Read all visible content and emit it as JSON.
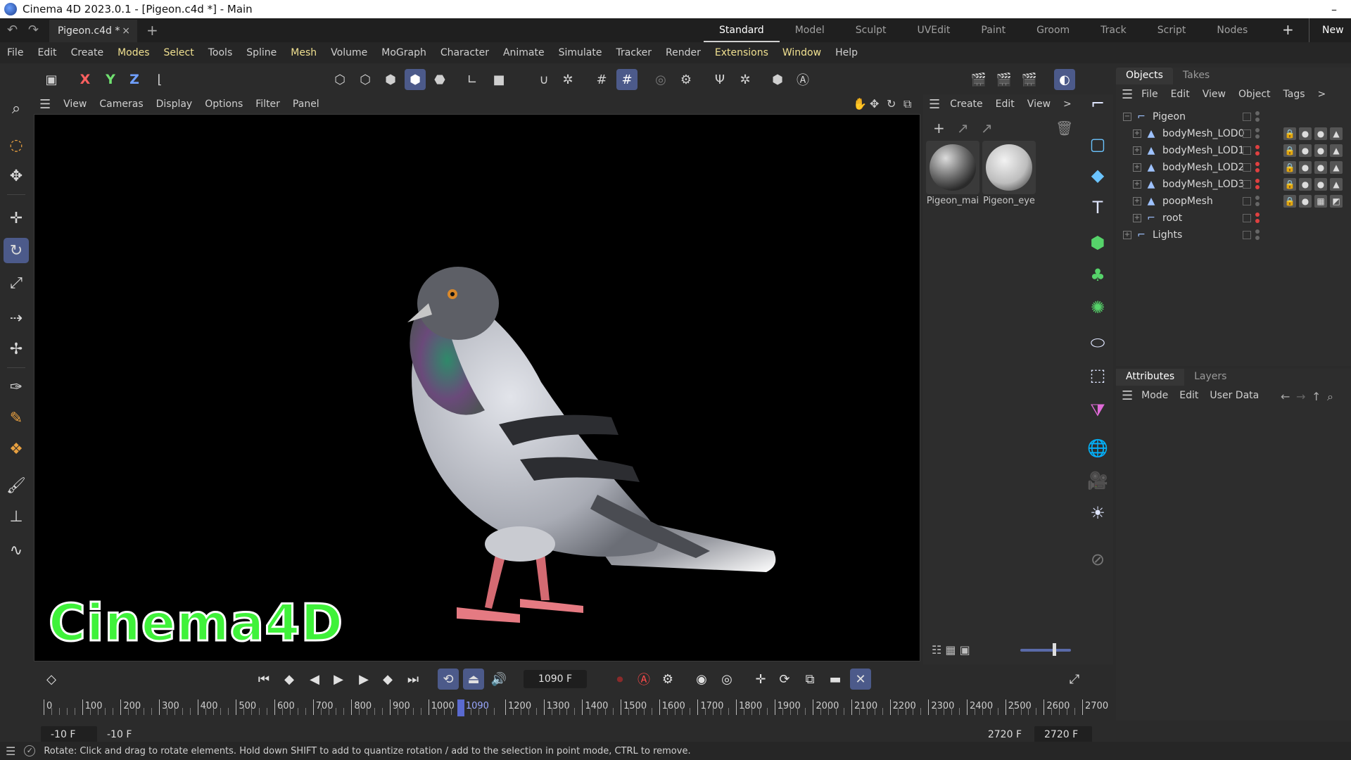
{
  "window": {
    "title": "Cinema 4D 2023.0.1 - [Pigeon.c4d *] - Main",
    "minimize": "–"
  },
  "tabbar": {
    "undo": "↶",
    "redo": "↷",
    "doc_tab": "Pigeon.c4d *",
    "doc_close": "×",
    "add_tab": "+",
    "layouts": [
      "Standard",
      "Model",
      "Sculpt",
      "UVEdit",
      "Paint",
      "Groom",
      "Track",
      "Script",
      "Nodes"
    ],
    "active_layout": "Standard",
    "add_layout": "+",
    "new_layout": "New L"
  },
  "menu": [
    "File",
    "Edit",
    "Create",
    "Modes",
    "Select",
    "Tools",
    "Spline",
    "Mesh",
    "Volume",
    "MoGraph",
    "Character",
    "Animate",
    "Simulate",
    "Tracker",
    "Render",
    "Extensions",
    "Window",
    "Help"
  ],
  "toolbar": {
    "x": "X",
    "y": "Y",
    "z": "Z"
  },
  "viewport": {
    "menu": [
      "View",
      "Cameras",
      "Display",
      "Options",
      "Filter",
      "Panel"
    ],
    "watermark": "Cinema4D"
  },
  "material_manager": {
    "menu": [
      "Create",
      "Edit",
      "View"
    ],
    "more": ">",
    "materials": [
      {
        "name": "Pigeon_mai"
      },
      {
        "name": "Pigeon_eye"
      }
    ]
  },
  "objects_panel": {
    "tabs": [
      "Objects",
      "Takes"
    ],
    "menu": [
      "File",
      "Edit",
      "View",
      "Object",
      "Tags"
    ],
    "more": ">",
    "rows": [
      {
        "name": "Pigeon",
        "level": 0,
        "icon": "null-icon"
      },
      {
        "name": "bodyMesh_LOD0",
        "level": 1,
        "icon": "mesh-icon"
      },
      {
        "name": "bodyMesh_LOD1",
        "level": 1,
        "icon": "mesh-icon"
      },
      {
        "name": "bodyMesh_LOD2",
        "level": 1,
        "icon": "mesh-icon"
      },
      {
        "name": "bodyMesh_LOD3",
        "level": 1,
        "icon": "mesh-icon"
      },
      {
        "name": "poopMesh",
        "level": 1,
        "icon": "mesh-icon"
      },
      {
        "name": "root",
        "level": 1,
        "icon": "joint-icon"
      },
      {
        "name": "Lights",
        "level": 0,
        "icon": "null-icon"
      }
    ]
  },
  "attributes_panel": {
    "tabs": [
      "Attributes",
      "Layers"
    ],
    "menu": [
      "Mode",
      "Edit",
      "User Data"
    ]
  },
  "timeline": {
    "current_frame": "1090 F",
    "ruler_labels": [
      "0",
      "100",
      "200",
      "300",
      "400",
      "500",
      "600",
      "700",
      "800",
      "900",
      "1000",
      "1090",
      "1200",
      "1300",
      "1400",
      "1500",
      "1600",
      "1700",
      "1800",
      "1900",
      "2000",
      "2100",
      "2200",
      "2300",
      "2400",
      "2500",
      "2600",
      "2700"
    ],
    "range_start": "-10 F",
    "range_start2": "-10 F",
    "range_end": "2720 F",
    "range_end2": "2720 F",
    "min_frame": -10,
    "max_frame": 2720,
    "playhead_frame": 1090
  },
  "status": {
    "message": "Rotate: Click and drag to rotate elements. Hold down SHIFT to add to quantize rotation / add to the selection in point mode, CTRL to remove."
  },
  "colors": {
    "accent": "#4c5a8a",
    "watermark": "#3ff23a",
    "record": "#ff4a4a"
  }
}
